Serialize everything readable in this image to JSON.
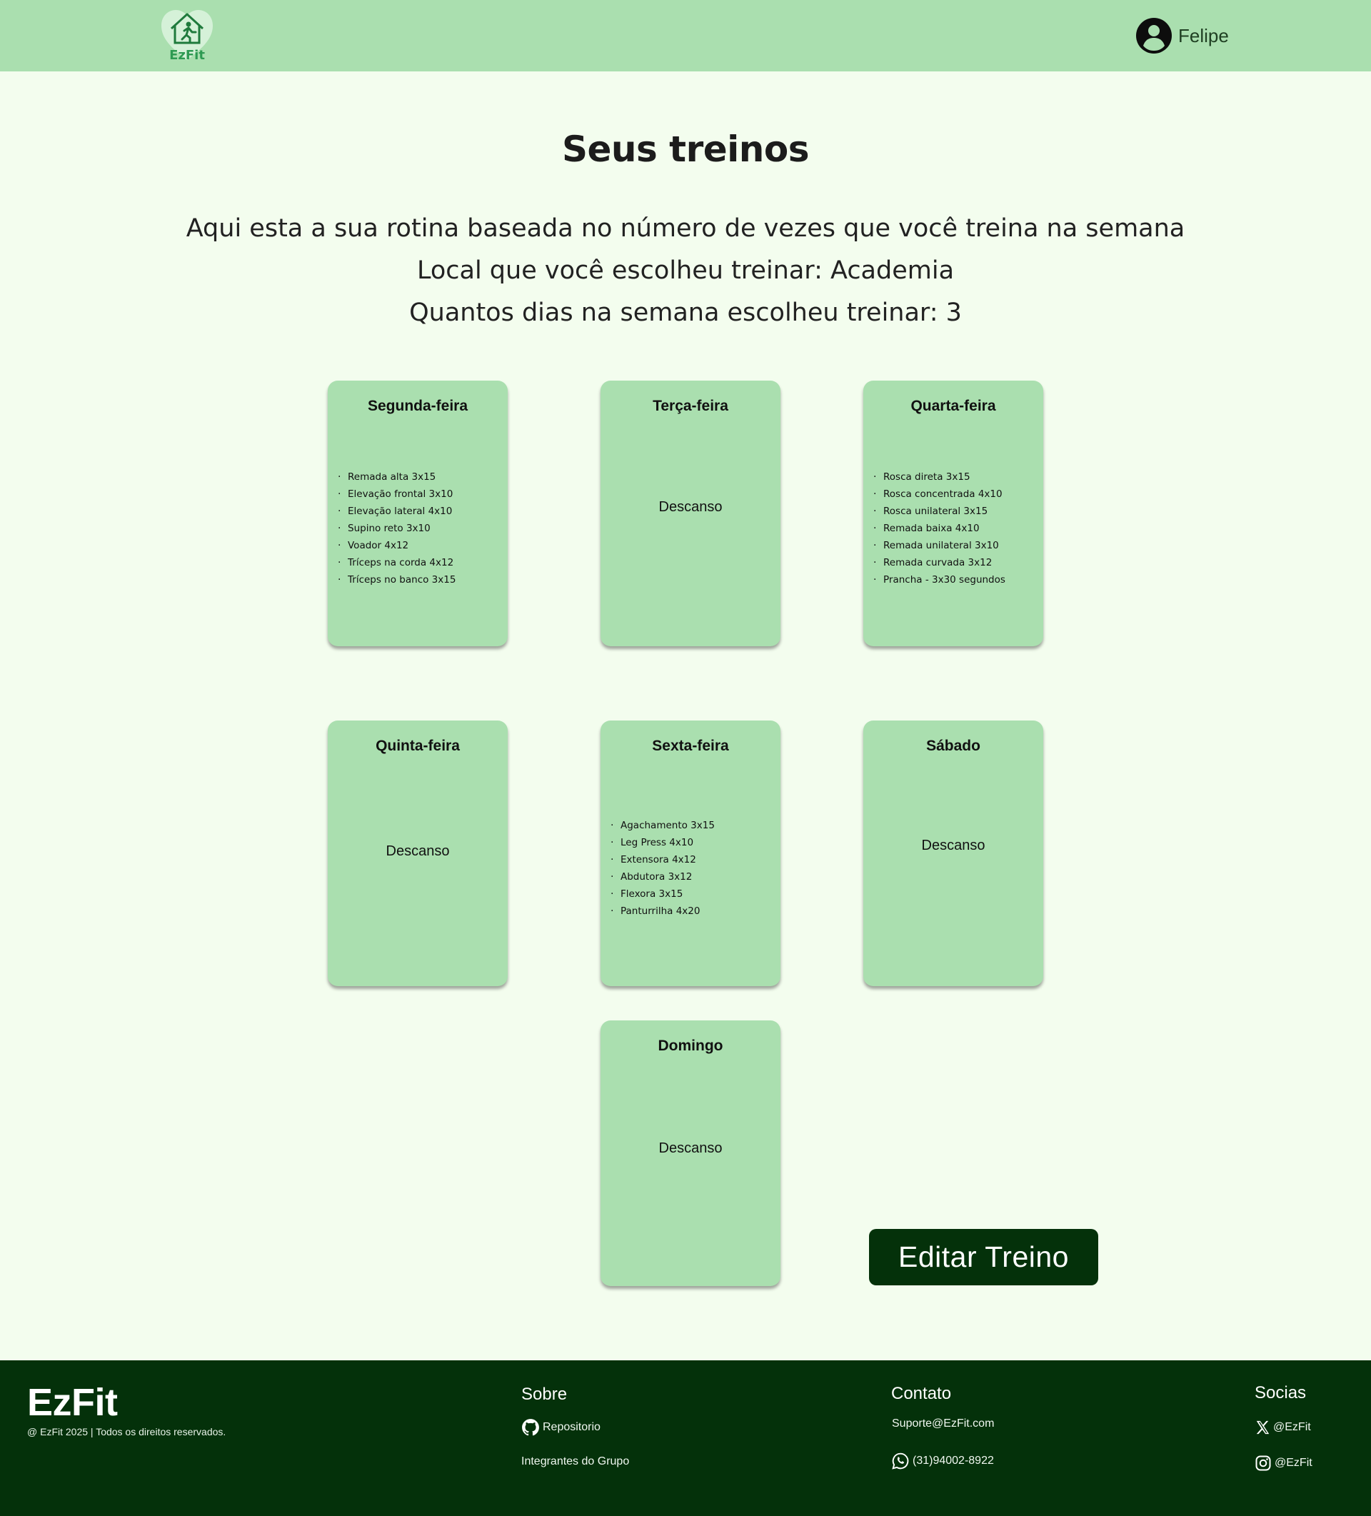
{
  "header": {
    "logo_text": "EzFit",
    "user_name": "Felipe"
  },
  "main": {
    "title": "Seus treinos",
    "intro": "Aqui esta a sua rotina baseada no número de vezes que você treina na semana",
    "location_line": "Local que você escolheu treinar: Academia",
    "days_line": "Quantos dias na semana escolheu treinar: 3"
  },
  "days": [
    {
      "name": "Segunda-feira",
      "exercises": [
        "Remada alta 3x15",
        "Elevação frontal 3x10",
        "Elevação lateral 4x10",
        "Supino reto 3x10",
        "Voador 4x12",
        "Tríceps na corda 4x12",
        "Tríceps no banco 3x15"
      ]
    },
    {
      "name": "Terça-feira",
      "rest": "Descanso"
    },
    {
      "name": "Quarta-feira",
      "exercises": [
        "Rosca direta 3x15",
        "Rosca concentrada 4x10",
        "Rosca unilateral 3x15",
        "Remada baixa 4x10",
        "Remada unilateral 3x10",
        "Remada curvada 3x12",
        "Prancha - 3x30 segundos"
      ]
    },
    {
      "name": "Quinta-feira",
      "rest": "Descanso"
    },
    {
      "name": "Sexta-feira",
      "exercises": [
        "Agachamento 3x15",
        "Leg Press 4x10",
        "Extensora 4x12",
        "Abdutora 3x12",
        "Flexora 3x15",
        "Panturrilha 4x20"
      ]
    },
    {
      "name": "Sábado",
      "rest": "Descanso"
    },
    {
      "name": "Domingo",
      "rest": "Descanso"
    }
  ],
  "edit_button": "Editar Treino",
  "footer": {
    "brand": "EzFit",
    "copyright": "@ EzFit 2025 | Todos os direitos reservados.",
    "about": {
      "heading": "Sobre",
      "repo": "Repositorio",
      "members": "Integrantes do Grupo"
    },
    "contact": {
      "heading": "Contato",
      "email": "Suporte@EzFit.com",
      "phone": "(31)94002-8922"
    },
    "social": {
      "heading": "Socias",
      "x": "@EzFit",
      "instagram": "@EzFit"
    }
  },
  "colors": {
    "header_bg": "#aadfaf",
    "page_bg": "#f3fdee",
    "card_bg": "#aadfaf",
    "dark_green": "#04310a"
  },
  "icons": [
    "ezfit-logo-icon",
    "user-avatar-icon",
    "github-icon",
    "whatsapp-icon",
    "x-icon",
    "instagram-icon"
  ]
}
